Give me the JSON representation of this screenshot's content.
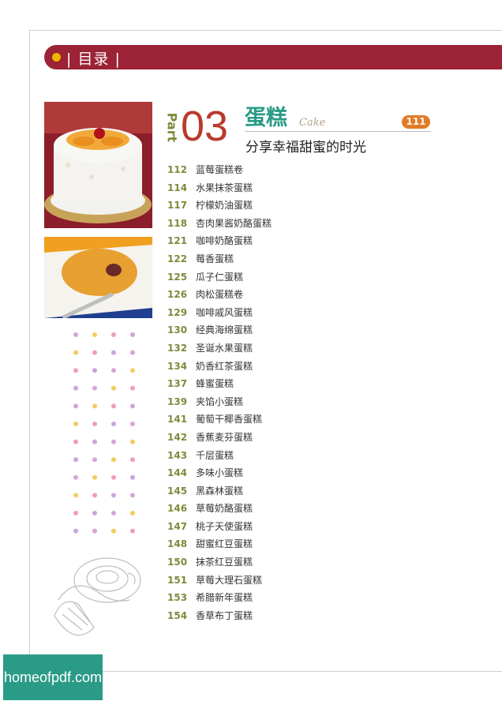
{
  "header": {
    "title": "| 目录 |",
    "bar_color": "#9b2335",
    "dot_color": "#f0b400"
  },
  "section": {
    "part_label": "Part",
    "part_number": "03",
    "title": "蛋糕",
    "script_title": "Cake",
    "subtitle": "分享幸福甜蜜的时光",
    "start_page": "111"
  },
  "toc": [
    {
      "page": "112",
      "title": "蓝莓蛋糕卷"
    },
    {
      "page": "114",
      "title": "水果抹茶蛋糕"
    },
    {
      "page": "117",
      "title": "柠檬奶油蛋糕"
    },
    {
      "page": "118",
      "title": "杏肉果酱奶酪蛋糕"
    },
    {
      "page": "121",
      "title": "咖啡奶酪蛋糕"
    },
    {
      "page": "122",
      "title": "莓香蛋糕"
    },
    {
      "page": "125",
      "title": "瓜子仁蛋糕"
    },
    {
      "page": "126",
      "title": "肉松蛋糕卷"
    },
    {
      "page": "129",
      "title": "咖啡戚风蛋糕"
    },
    {
      "page": "130",
      "title": "经典海绵蛋糕"
    },
    {
      "page": "132",
      "title": "圣诞水果蛋糕"
    },
    {
      "page": "134",
      "title": "奶香红茶蛋糕"
    },
    {
      "page": "137",
      "title": "蜂蜜蛋糕"
    },
    {
      "page": "139",
      "title": "夹馅小蛋糕"
    },
    {
      "page": "141",
      "title": "葡萄干椰香蛋糕"
    },
    {
      "page": "142",
      "title": "香蕉麦芬蛋糕"
    },
    {
      "page": "143",
      "title": "千层蛋糕"
    },
    {
      "page": "144",
      "title": "多味小蛋糕"
    },
    {
      "page": "145",
      "title": "黑森林蛋糕"
    },
    {
      "page": "146",
      "title": "草莓奶酪蛋糕"
    },
    {
      "page": "147",
      "title": "桃子天使蛋糕"
    },
    {
      "page": "148",
      "title": "甜蜜红豆蛋糕"
    },
    {
      "page": "150",
      "title": "抹茶红豆蛋糕"
    },
    {
      "page": "151",
      "title": "草莓大理石蛋糕"
    },
    {
      "page": "153",
      "title": "希腊新年蛋糕"
    },
    {
      "page": "154",
      "title": "香草布丁蛋糕"
    }
  ],
  "watermark": "homeofpdf.com",
  "decor": {
    "photo1": "cake-with-peaches-and-cherry",
    "photo2": "muffin-in-dish",
    "illustration": "coffee-cup-and-croissant-icon",
    "dot_colors": [
      "#d8a4d4",
      "#f5cb62",
      "#ef9fb6",
      "#c8a6dc"
    ]
  }
}
